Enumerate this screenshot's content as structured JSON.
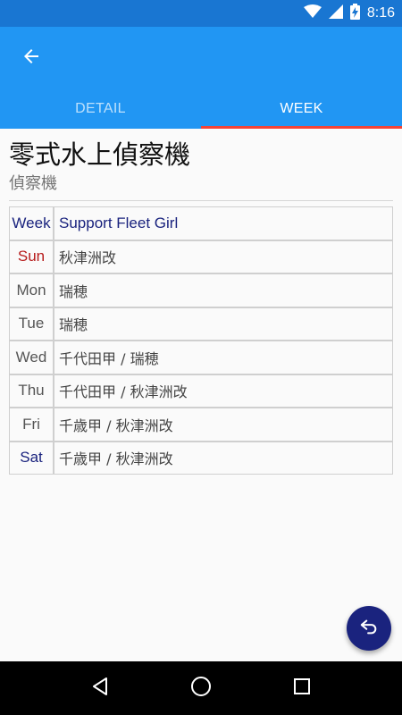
{
  "status_bar": {
    "time": "8:16"
  },
  "tabs": [
    {
      "label": "DETAIL"
    },
    {
      "label": "WEEK"
    }
  ],
  "item": {
    "name": "零式水上偵察機",
    "type": "偵察機"
  },
  "week_table": {
    "header": {
      "day": "Week",
      "girl": "Support Fleet Girl"
    },
    "rows": [
      {
        "day": "Sun",
        "girl": "秋津洲改"
      },
      {
        "day": "Mon",
        "girl": "瑞穂"
      },
      {
        "day": "Tue",
        "girl": "瑞穂"
      },
      {
        "day": "Wed",
        "girl": "千代田甲 / 瑞穂"
      },
      {
        "day": "Thu",
        "girl": "千代田甲 / 秋津洲改"
      },
      {
        "day": "Fri",
        "girl": "千歳甲 / 秋津洲改"
      },
      {
        "day": "Sat",
        "girl": "千歳甲 / 秋津洲改"
      }
    ]
  },
  "colors": {
    "primary": "#2196f3",
    "primary_dark": "#1976d2",
    "tab_indicator": "#f44336",
    "fab": "#1a237e",
    "sunday": "#b71c1c",
    "saturday": "#1a237e"
  },
  "icons": {
    "status": [
      "wifi-icon",
      "signal-icon",
      "battery-charging-icon"
    ],
    "app_bar": "arrow-back-icon",
    "fab": "undo-icon",
    "nav": [
      "nav-back-icon",
      "nav-home-icon",
      "nav-recents-icon"
    ]
  }
}
